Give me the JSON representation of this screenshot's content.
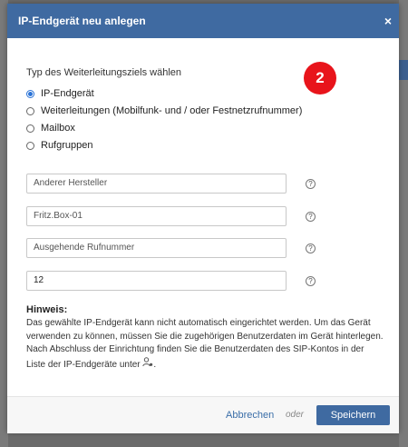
{
  "dialog": {
    "title": "IP-Endgerät neu anlegen",
    "close_label": "×",
    "step_badge": "2"
  },
  "target_type": {
    "label": "Typ des Weiterleitungsziels wählen",
    "options": [
      {
        "label": "IP-Endgerät",
        "selected": true
      },
      {
        "label": "Weiterleitungen (Mobilfunk- und / oder Festnetzrufnummer)",
        "selected": false
      },
      {
        "label": "Mailbox",
        "selected": false
      },
      {
        "label": "Rufgruppen",
        "selected": false
      }
    ]
  },
  "fields": [
    {
      "value": "",
      "placeholder": "Anderer Hersteller",
      "help": "?"
    },
    {
      "value": "",
      "placeholder": "Fritz.Box-01",
      "help": "?"
    },
    {
      "value": "",
      "placeholder": "Ausgehende Rufnummer",
      "help": "?"
    },
    {
      "value": "12",
      "placeholder": "",
      "help": "?"
    }
  ],
  "hint": {
    "title": "Hinweis:",
    "text": "Das gewählte IP-Endgerät kann nicht automatisch eingerichtet werden. Um das Gerät verwenden zu können, müssen Sie die zugehörigen Benutzerdaten im Gerät hinterlegen. Nach Abschluss der Einrichtung finden Sie die Benutzerdaten des SIP-Kontos in der Liste der IP-Endgeräte unter",
    "end": ".",
    "icon": "user-settings-icon"
  },
  "footer": {
    "cancel_label": "Abbrechen",
    "or_label": "oder",
    "save_label": "Speichern"
  },
  "colors": {
    "header": "#3f6aa1",
    "badge": "#e8141b",
    "link": "#3a6ea8"
  }
}
